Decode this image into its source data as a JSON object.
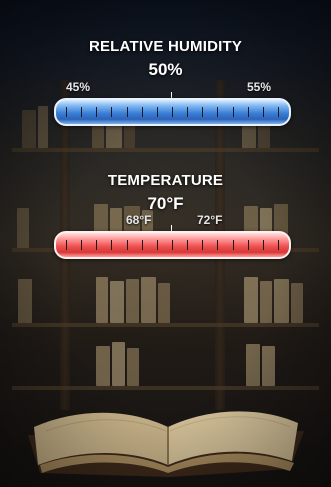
{
  "humidity": {
    "title": "RELATIVE HUMIDITY",
    "value": "50%",
    "low_label": "45%",
    "high_label": "55%",
    "level_percent": 50,
    "color": "#3a7fd8"
  },
  "temperature": {
    "title": "TEMPERATURE",
    "value": "70°F",
    "low_label": "68°F",
    "high_label": "72°F",
    "level_percent": 50,
    "color": "#f05252"
  }
}
